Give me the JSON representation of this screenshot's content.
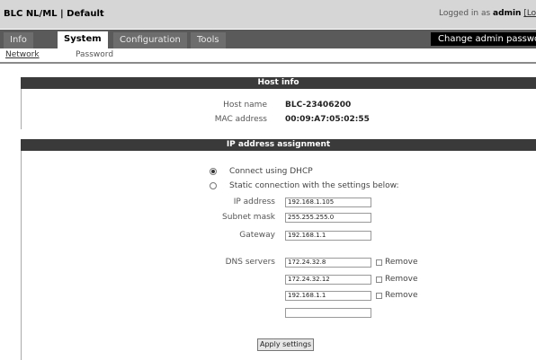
{
  "header": {
    "title": "BLC NL/ML | Default",
    "login_prefix": "Logged in as",
    "user": "admin",
    "logout": "[Log ou"
  },
  "tabs": [
    {
      "label": "Info",
      "active": false
    },
    {
      "label": "System",
      "active": true
    },
    {
      "label": "Configuration",
      "active": false
    },
    {
      "label": "Tools",
      "active": false
    }
  ],
  "admin_password_button": "Change admin passwo",
  "subnav": [
    {
      "label": "Network",
      "active": true
    },
    {
      "label": "Password",
      "active": false
    }
  ],
  "host_info": {
    "title": "Host info",
    "host_name_label": "Host name",
    "host_name": "BLC-23406200",
    "mac_label": "MAC address",
    "mac": "00:09:A7:05:02:55"
  },
  "ip_assignment": {
    "title": "IP address assignment",
    "dhcp_label": "Connect using DHCP",
    "dhcp_selected": true,
    "static_label": "Static connection with the settings below:",
    "ip_label": "IP address",
    "ip_value": "192.168.1.105",
    "mask_label": "Subnet mask",
    "mask_value": "255.255.255.0",
    "gateway_label": "Gateway",
    "gateway_value": "192.168.1.1",
    "dns_label": "DNS servers",
    "dns": [
      {
        "value": "172.24.32.8",
        "remove_label": "Remove"
      },
      {
        "value": "172.24.32.12",
        "remove_label": "Remove"
      },
      {
        "value": "192.168.1.1",
        "remove_label": "Remove"
      },
      {
        "value": ""
      }
    ],
    "apply_label": "Apply settings"
  }
}
